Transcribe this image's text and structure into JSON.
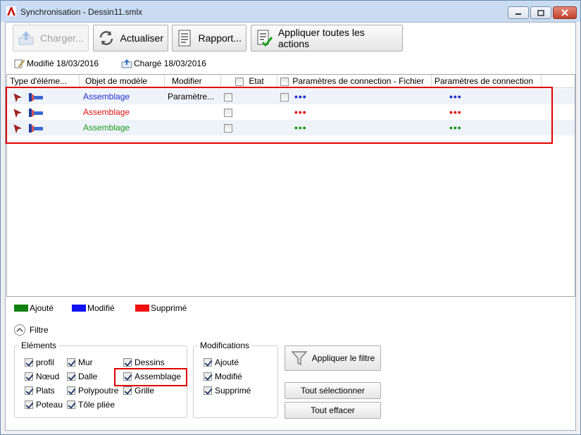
{
  "window": {
    "title": "Synchronisation - Dessin11.smlx"
  },
  "toolbar": {
    "load_label": "Charger...",
    "refresh_label": "Actualiser",
    "report_label": "Rapport...",
    "apply_all_label": "Appliquer toutes les actions"
  },
  "status": {
    "modified": "Modifié 18/03/2016",
    "loaded": "Chargé 18/03/2016"
  },
  "grid": {
    "columns": [
      "Type d'éléme...",
      "Objet de modèle",
      "Modifier",
      "Etat",
      "Paramètres de connection - Fichier",
      "Paramètres de connection"
    ],
    "rows": [
      {
        "object": "Assemblage",
        "modifier": "Paramètre...",
        "etat_checked": false,
        "file_checkbox": true,
        "file_params": "•••",
        "params": "•••",
        "color": "#1f2fd0"
      },
      {
        "object": "Assemblage",
        "modifier": "",
        "etat_checked": false,
        "file_checkbox": false,
        "file_params": "•••",
        "params": "•••",
        "color": "#e01010"
      },
      {
        "object": "Assemblage",
        "modifier": "",
        "etat_checked": false,
        "file_checkbox": false,
        "file_params": "•••",
        "params": "•••",
        "color": "#1a9a1a"
      }
    ]
  },
  "legend": {
    "added": {
      "label": "Ajouté",
      "color": "#108010"
    },
    "modified": {
      "label": "Modifié",
      "color": "#1010f0"
    },
    "deleted": {
      "label": "Supprimé",
      "color": "#f01010"
    }
  },
  "filter": {
    "toggle_label": "Filtre",
    "elements_title": "Eléments",
    "elements": [
      {
        "label": "profil",
        "checked": true
      },
      {
        "label": "Nœud",
        "checked": true
      },
      {
        "label": "Plats",
        "checked": true
      },
      {
        "label": "Poteau",
        "checked": true
      },
      {
        "label": "Mur",
        "checked": true
      },
      {
        "label": "Dalle",
        "checked": true
      },
      {
        "label": "Polypoutre",
        "checked": true
      },
      {
        "label": "Tôle pliée",
        "checked": true
      },
      {
        "label": "Dessins",
        "checked": true
      },
      {
        "label": "Assemblage",
        "checked": true
      },
      {
        "label": "Grille",
        "checked": true
      }
    ],
    "modifications_title": "Modifications",
    "modifications": [
      {
        "label": "Ajouté",
        "checked": true
      },
      {
        "label": "Modifié",
        "checked": true
      },
      {
        "label": "Supprimé",
        "checked": true
      }
    ],
    "apply_filter_label": "Appliquer le filtre",
    "select_all_label": "Tout sélectionner",
    "clear_all_label": "Tout effacer"
  }
}
